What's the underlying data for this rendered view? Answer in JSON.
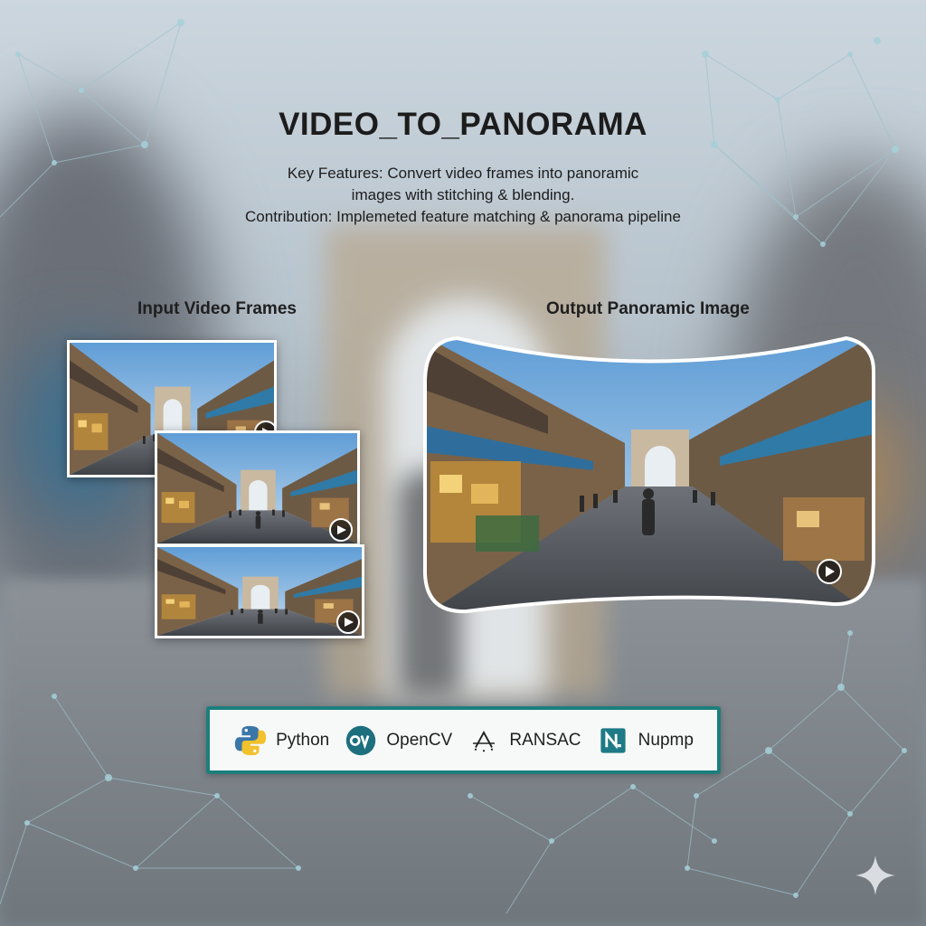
{
  "title": "VIDEO_TO_PANORAMA",
  "description": {
    "line1": "Key Features: Convert video frames into panoramic",
    "line2": "images with stitching & blending.",
    "line3": "Contribution: Implemeted feature matching & panorama pipeline"
  },
  "sections": {
    "input_label": "Input Video Frames",
    "output_label": "Output Panoramic Image"
  },
  "tech_stack": [
    {
      "name": "Python",
      "icon": "python-icon"
    },
    {
      "name": "OpenCV",
      "icon": "opencv-icon"
    },
    {
      "name": "RANSAC",
      "icon": "ransac-icon"
    },
    {
      "name": "Nupmp",
      "icon": "numpy-icon"
    }
  ],
  "colors": {
    "accent": "#1c7f7c",
    "sky": "#7fb2e0",
    "arch": "#c9b9a0"
  }
}
